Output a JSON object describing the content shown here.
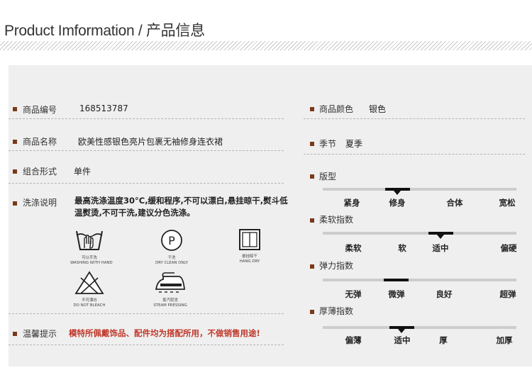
{
  "header": {
    "title": "Product Imformation / 产品信息"
  },
  "left_fields": [
    {
      "label": "商品编号",
      "value": "168513787"
    },
    {
      "label": "商品名称",
      "value": "欧美性感银色亮片包裹无袖修身连衣裙"
    },
    {
      "label": "组合形式",
      "value": "单件"
    },
    {
      "label": "洗涤说明",
      "value": "最高洗涤温度30°C,缓和程序,不可以漂白,悬挂晾干,熨斗低温熨烫,不可干洗,建议分色洗涤。"
    },
    {
      "label": "温馨提示",
      "value": "模特所佩戴饰品、配件均为搭配所用，不做销售用途!"
    }
  ],
  "care_icons": [
    {
      "icon": "hand-wash-icon",
      "zh": "可以手洗",
      "en": "WASHING WITH HAND"
    },
    {
      "icon": "dry-clean-icon",
      "symbol": "P",
      "zh": "干洗",
      "en": "DRY CLEAN ONLY"
    },
    {
      "icon": "hang-dry-icon",
      "zh": "悬挂晾干",
      "en": "HANG DRY"
    },
    {
      "icon": "no-bleach-icon",
      "zh": "不可漂白",
      "en": "DO NOT BLEACH"
    },
    {
      "icon": "steam-iron-icon",
      "zh": "蒸汽熨烫",
      "en": "STEAM PRESSING"
    }
  ],
  "right_fields": [
    {
      "label": "商品颜色",
      "value": "银色"
    },
    {
      "label": "季节",
      "value": "夏季"
    }
  ],
  "scales": [
    {
      "label": "版型",
      "options": [
        "紧身",
        "修身",
        "合体",
        "宽松"
      ],
      "selected": 1
    },
    {
      "label": "柔软指数",
      "options": [
        "柔软",
        "软",
        "适中",
        "偏硬"
      ],
      "selected": 2
    },
    {
      "label": "弹力指数",
      "options": [
        "无弹",
        "微弹",
        "良好",
        "超弹"
      ],
      "selected": 1
    },
    {
      "label": "厚薄指数",
      "options": [
        "偏薄",
        "适中",
        "厚",
        "加厚"
      ],
      "selected": 1
    }
  ],
  "colors": {
    "bullet": "#7a3a1a",
    "warning_text": "#c0392b",
    "panel_bg": "#efefef"
  }
}
